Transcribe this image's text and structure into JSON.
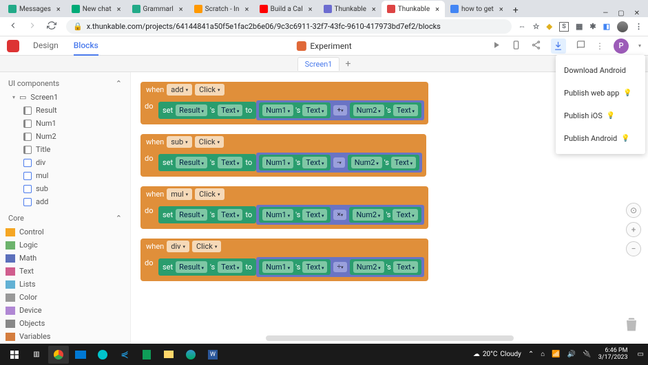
{
  "browser": {
    "tabs": [
      {
        "label": "Messages",
        "favicon": "#2a8"
      },
      {
        "label": "New chat",
        "favicon": "#0a7"
      },
      {
        "label": "Grammarl",
        "favicon": "#2a8"
      },
      {
        "label": "Scratch - In",
        "favicon": "#f90"
      },
      {
        "label": "Build a Cal",
        "favicon": "#f00"
      },
      {
        "label": "Thunkable",
        "favicon": "#6c6cd0"
      },
      {
        "label": "Thunkable",
        "favicon": "#d44",
        "active": true
      },
      {
        "label": "how to get",
        "favicon": "#4285f4"
      }
    ],
    "url": "x.thunkable.com/projects/64144841a50f5e1fac2b6e06/9c3c6911-32f7-43fc-9610-417973bd7ef2/blocks",
    "ext_s": "S"
  },
  "app": {
    "nav": {
      "design": "Design",
      "blocks": "Blocks"
    },
    "title": "Experiment",
    "avatar": "P"
  },
  "screen_tabs": {
    "active": "Screen1"
  },
  "sidebar": {
    "sections": {
      "ui": "UI components",
      "core": "Core"
    },
    "tree_root": "Screen1",
    "items": [
      "Result",
      "Num1",
      "Num2",
      "Title",
      "div",
      "mul",
      "sub",
      "add"
    ],
    "core_items": [
      {
        "label": "Control",
        "color": "#f5a623"
      },
      {
        "label": "Logic",
        "color": "#6cb36c"
      },
      {
        "label": "Math",
        "color": "#5b6fbb"
      },
      {
        "label": "Text",
        "color": "#d05d8e"
      },
      {
        "label": "Lists",
        "color": "#62b1d4"
      },
      {
        "label": "Color",
        "color": "#999"
      },
      {
        "label": "Device",
        "color": "#b087d4"
      },
      {
        "label": "Objects",
        "color": "#888"
      },
      {
        "label": "Variables",
        "color": "#d47d3e"
      }
    ]
  },
  "blocks": {
    "when": "when",
    "do": "do",
    "click": "Click",
    "set": "set",
    "s": "'s",
    "text_prop": "Text",
    "to": "to",
    "result": "Result",
    "num1": "Num1",
    "num2": "Num2",
    "events": [
      {
        "comp": "add",
        "op": "+"
      },
      {
        "comp": "sub",
        "op": "-"
      },
      {
        "comp": "mul",
        "op": "×"
      },
      {
        "comp": "div",
        "op": "÷"
      }
    ]
  },
  "dropdown": {
    "items": [
      {
        "label": "Download Android",
        "bulb": false
      },
      {
        "label": "Publish web app",
        "bulb": true
      },
      {
        "label": "Publish iOS",
        "bulb": true
      },
      {
        "label": "Publish Android",
        "bulb": true
      }
    ]
  },
  "taskbar": {
    "weather_temp": "20°C",
    "weather_desc": "Cloudy",
    "time": "6:46 PM",
    "date": "3/17/2023"
  }
}
